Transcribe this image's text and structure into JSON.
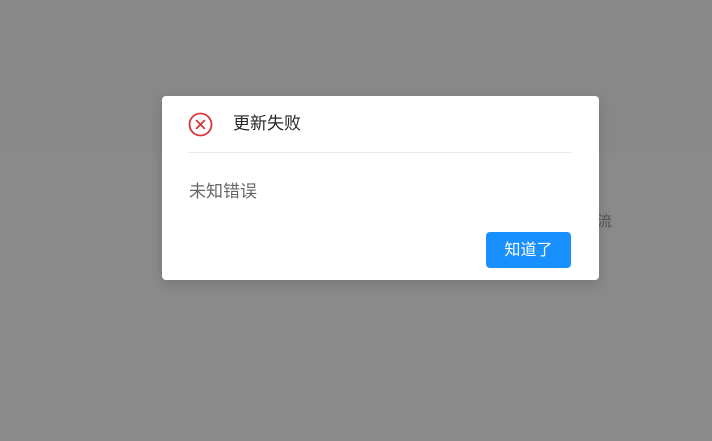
{
  "background": {
    "text_fragment": "流"
  },
  "modal": {
    "icon": "close-circle-icon",
    "icon_color": "#d9363e",
    "title": "更新失败",
    "content": "未知错误",
    "ok_label": "知道了",
    "accent_color": "#1890ff"
  }
}
